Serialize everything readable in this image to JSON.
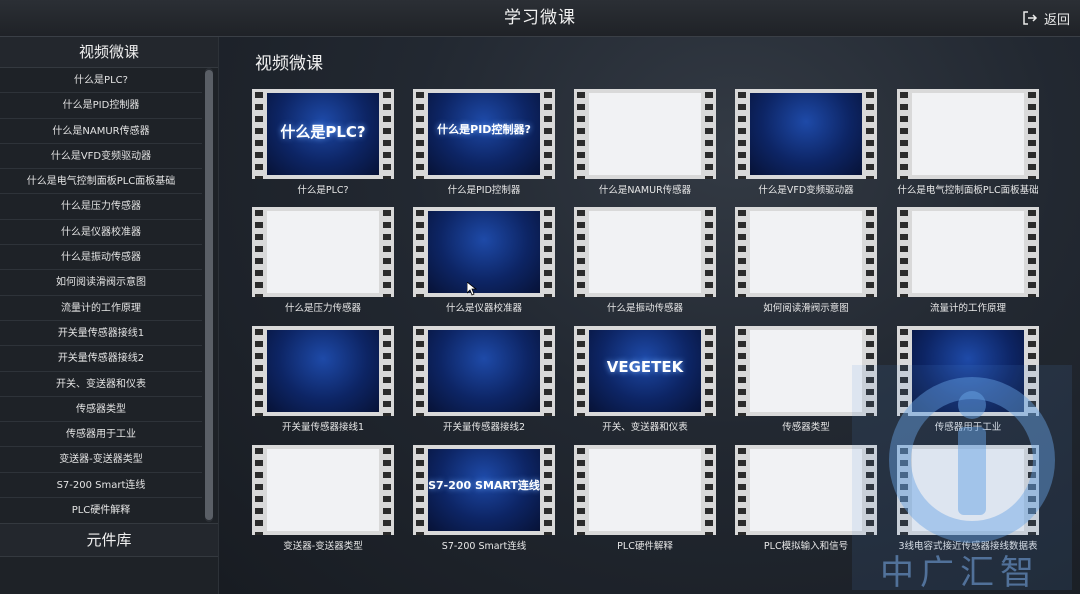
{
  "window": {
    "title": "学习微课",
    "back_label": "返回"
  },
  "sidebar": {
    "header": "视频微课",
    "items": [
      "什么是PLC?",
      "什么是PID控制器",
      "什么是NAMUR传感器",
      "什么是VFD变频驱动器",
      "什么是电气控制面板PLC面板基础",
      "什么是压力传感器",
      "什么是仪器校准器",
      "什么是振动传感器",
      "如何阅读滑阀示意图",
      "流量计的工作原理",
      "开关量传感器接线1",
      "开关量传感器接线2",
      "开关、变送器和仪表",
      "传感器类型",
      "传感器用于工业",
      "变送器-变送器类型",
      "S7-200 Smart连线",
      "PLC硬件解释"
    ],
    "footer": "元件库"
  },
  "main": {
    "title": "视频微课",
    "videos": [
      {
        "caption": "什么是PLC?",
        "thumb_text": "什么是PLC?",
        "style": "dark"
      },
      {
        "caption": "什么是PID控制器",
        "thumb_text": "什么是PID控制器?",
        "style": "dark"
      },
      {
        "caption": "什么是NAMUR传感器",
        "thumb_text": "",
        "style": "light"
      },
      {
        "caption": "什么是VFD变频驱动器",
        "thumb_text": "",
        "style": "dark"
      },
      {
        "caption": "什么是电气控制面板PLC面板基础",
        "thumb_text": "",
        "style": "light"
      },
      {
        "caption": "什么是压力传感器",
        "thumb_text": "",
        "style": "light"
      },
      {
        "caption": "什么是仪器校准器",
        "thumb_text": "",
        "style": "dark"
      },
      {
        "caption": "什么是振动传感器",
        "thumb_text": "",
        "style": "light"
      },
      {
        "caption": "如何阅读滑阀示意图",
        "thumb_text": "",
        "style": "light"
      },
      {
        "caption": "流量计的工作原理",
        "thumb_text": "",
        "style": "light"
      },
      {
        "caption": "开关量传感器接线1",
        "thumb_text": "",
        "style": "dark"
      },
      {
        "caption": "开关量传感器接线2",
        "thumb_text": "",
        "style": "dark"
      },
      {
        "caption": "开关、变送器和仪表",
        "thumb_text": "VEGETEK",
        "style": "dark"
      },
      {
        "caption": "传感器类型",
        "thumb_text": "",
        "style": "light"
      },
      {
        "caption": "传感器用于工业",
        "thumb_text": "",
        "style": "dark"
      },
      {
        "caption": "变送器-变送器类型",
        "thumb_text": "",
        "style": "light"
      },
      {
        "caption": "S7-200 Smart连线",
        "thumb_text": "S7-200 SMART连线",
        "style": "dark"
      },
      {
        "caption": "PLC硬件解释",
        "thumb_text": "",
        "style": "light"
      },
      {
        "caption": "PLC模拟输入和信号",
        "thumb_text": "",
        "style": "light"
      },
      {
        "caption": "3线电容式接近传感器接线数据表",
        "thumb_text": "",
        "style": "light"
      }
    ]
  },
  "watermark": {
    "text": "中广汇智",
    "color": "#6aa6e6"
  },
  "icons": {
    "back": "logout-icon",
    "cursor": "mouse-pointer-icon"
  }
}
